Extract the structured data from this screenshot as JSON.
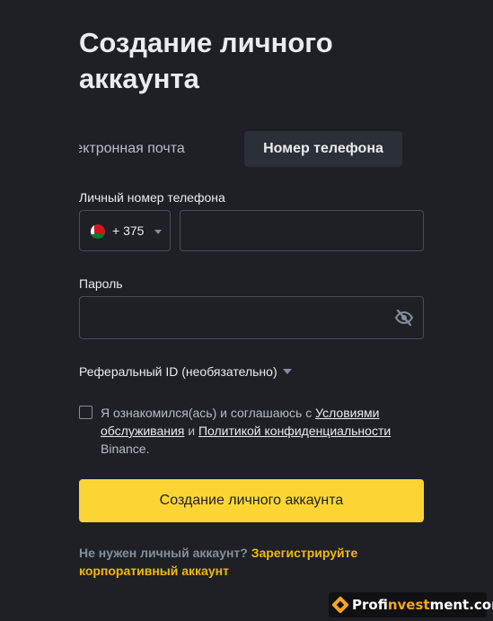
{
  "page": {
    "title": "Создание личного аккаунта"
  },
  "tabs": {
    "email_label": "лектронная почта",
    "phone_label": "Номер телефона",
    "active": "phone"
  },
  "phone_field": {
    "label": "Личный номер телефона",
    "country_code": "+ 375",
    "country_flag": "belarus-flag-icon",
    "value": ""
  },
  "password_field": {
    "label": "Пароль",
    "value": "",
    "toggle_icon": "eye-slash-icon"
  },
  "referral": {
    "label": "Реферальный ID (необязательно)"
  },
  "agreement": {
    "checked": false,
    "text_before": "Я ознакомился(ась) и соглашаюсь с ",
    "terms_link": "Условиями обслуживания",
    "conjunction": " и ",
    "privacy_link": "Политикой конфиденциальности",
    "text_after": " Binance."
  },
  "submit": {
    "label": "Создание личного аккаунта"
  },
  "footer": {
    "question": "Не нужен личный аккаунт? ",
    "link": "Зарегистрируйте корпоративный аккаунт"
  },
  "watermark": {
    "part1": "Prof",
    "part2": "invest",
    "part3": "ment.com"
  },
  "colors": {
    "background": "#1e2026",
    "accent": "#fcd535",
    "link": "#f0b90b",
    "border": "#474d57"
  }
}
